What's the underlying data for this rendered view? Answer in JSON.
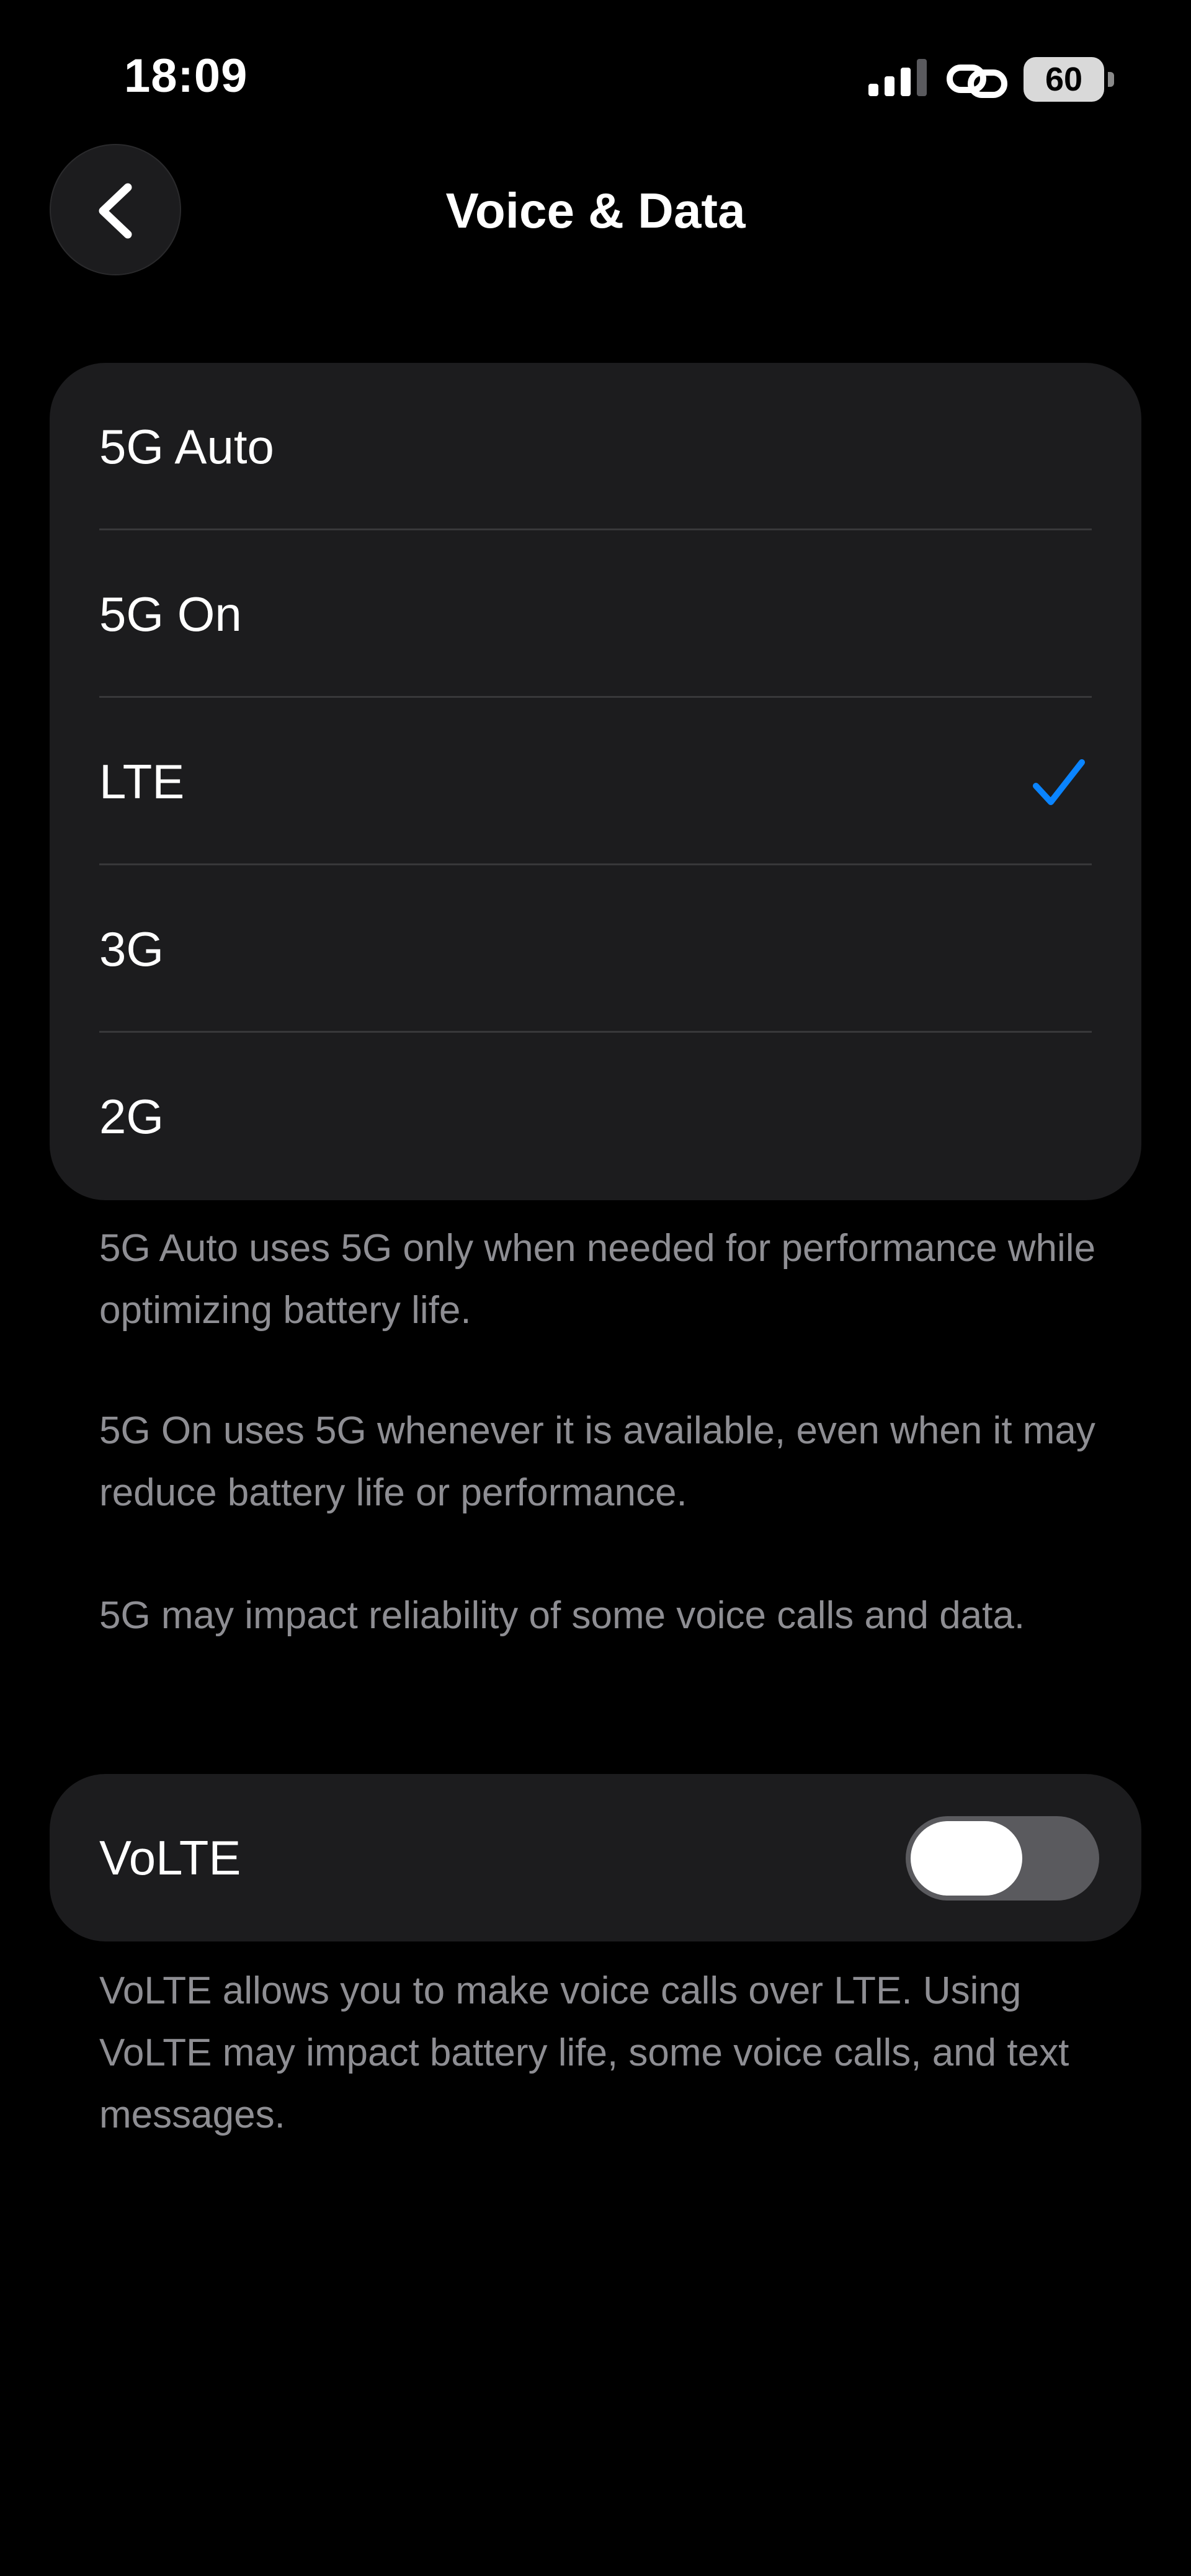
{
  "status_bar": {
    "time": "18:09",
    "battery": "60",
    "icons": [
      "cellular-signal-icon",
      "link-icon",
      "battery-icon"
    ]
  },
  "nav": {
    "title": "Voice & Data",
    "back_icon": "chevron-left-icon"
  },
  "network_options": [
    {
      "label": "5G Auto",
      "selected": false
    },
    {
      "label": "5G On",
      "selected": false
    },
    {
      "label": "LTE",
      "selected": true
    },
    {
      "label": "3G",
      "selected": false
    },
    {
      "label": "2G",
      "selected": false
    }
  ],
  "footnotes": {
    "five_g_auto": "5G Auto uses 5G only when needed for performance while optimizing battery life.",
    "five_g_on": "5G On uses 5G whenever it is available, even when it may reduce battery life or performance.",
    "reliability": "5G may impact reliability of some voice calls and data."
  },
  "volte": {
    "label": "VoLTE",
    "enabled": false,
    "description": "VoLTE allows you to make voice calls over LTE. Using VoLTE may impact battery life, some voice calls, and text messages."
  },
  "colors": {
    "background": "#000000",
    "group_background": "#1c1c1e",
    "separator": "#38383a",
    "footnote_text": "#8e8e93",
    "accent": "#0a84ff",
    "toggle_off": "#5a5a5e"
  }
}
